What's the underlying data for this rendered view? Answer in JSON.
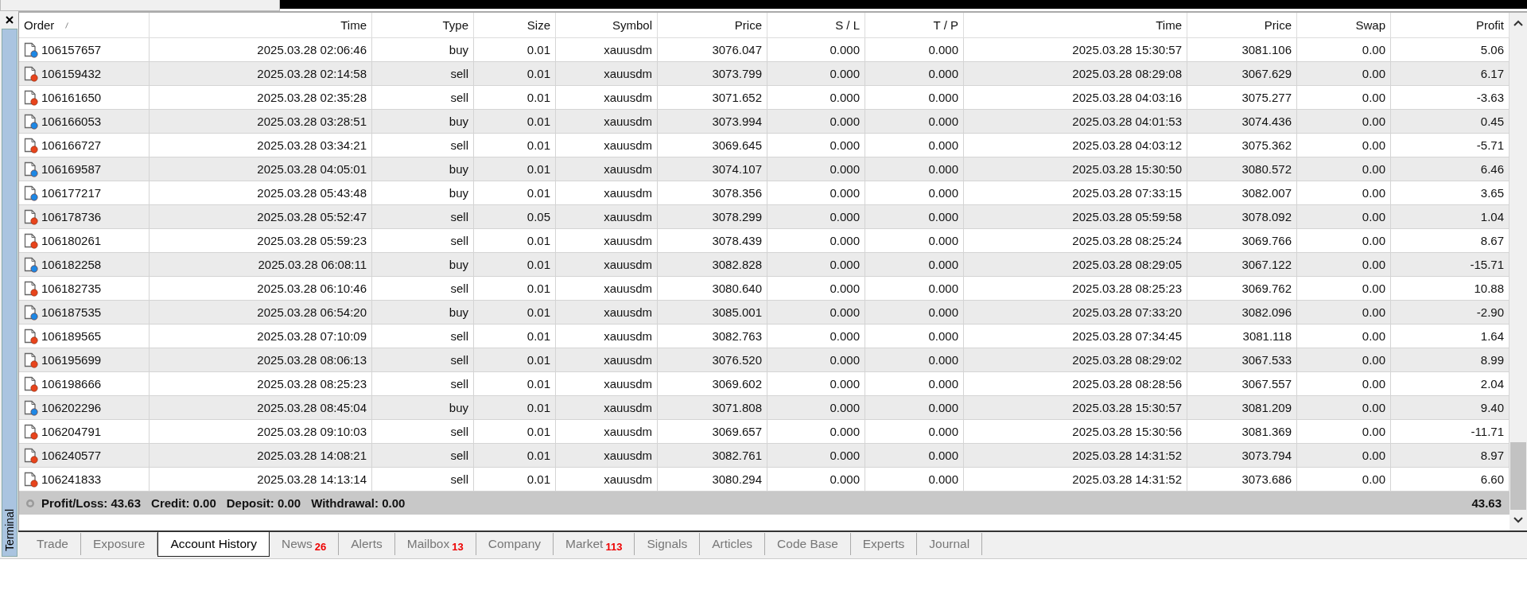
{
  "panel": {
    "title": "Terminal"
  },
  "table": {
    "columns": [
      {
        "label": "Order",
        "sorted": true
      },
      {
        "label": "Time",
        "sorted": false
      },
      {
        "label": "Type",
        "sorted": false
      },
      {
        "label": "Size",
        "sorted": false
      },
      {
        "label": "Symbol",
        "sorted": false
      },
      {
        "label": "Price",
        "sorted": false
      },
      {
        "label": "S / L",
        "sorted": false
      },
      {
        "label": "T / P",
        "sorted": false
      },
      {
        "label": "Time",
        "sorted": false
      },
      {
        "label": "Price",
        "sorted": false
      },
      {
        "label": "Swap",
        "sorted": false
      },
      {
        "label": "Profit",
        "sorted": false
      }
    ],
    "rows": [
      {
        "kind": "buy",
        "cells": [
          "106157657",
          "2025.03.28 02:06:46",
          "buy",
          "0.01",
          "xauusdm",
          "3076.047",
          "0.000",
          "0.000",
          "2025.03.28 15:30:57",
          "3081.106",
          "0.00",
          "5.06"
        ]
      },
      {
        "kind": "sell",
        "cells": [
          "106159432",
          "2025.03.28 02:14:58",
          "sell",
          "0.01",
          "xauusdm",
          "3073.799",
          "0.000",
          "0.000",
          "2025.03.28 08:29:08",
          "3067.629",
          "0.00",
          "6.17"
        ]
      },
      {
        "kind": "sell",
        "cells": [
          "106161650",
          "2025.03.28 02:35:28",
          "sell",
          "0.01",
          "xauusdm",
          "3071.652",
          "0.000",
          "0.000",
          "2025.03.28 04:03:16",
          "3075.277",
          "0.00",
          "-3.63"
        ]
      },
      {
        "kind": "buy",
        "cells": [
          "106166053",
          "2025.03.28 03:28:51",
          "buy",
          "0.01",
          "xauusdm",
          "3073.994",
          "0.000",
          "0.000",
          "2025.03.28 04:01:53",
          "3074.436",
          "0.00",
          "0.45"
        ]
      },
      {
        "kind": "sell",
        "cells": [
          "106166727",
          "2025.03.28 03:34:21",
          "sell",
          "0.01",
          "xauusdm",
          "3069.645",
          "0.000",
          "0.000",
          "2025.03.28 04:03:12",
          "3075.362",
          "0.00",
          "-5.71"
        ]
      },
      {
        "kind": "buy",
        "cells": [
          "106169587",
          "2025.03.28 04:05:01",
          "buy",
          "0.01",
          "xauusdm",
          "3074.107",
          "0.000",
          "0.000",
          "2025.03.28 15:30:50",
          "3080.572",
          "0.00",
          "6.46"
        ]
      },
      {
        "kind": "buy",
        "cells": [
          "106177217",
          "2025.03.28 05:43:48",
          "buy",
          "0.01",
          "xauusdm",
          "3078.356",
          "0.000",
          "0.000",
          "2025.03.28 07:33:15",
          "3082.007",
          "0.00",
          "3.65"
        ]
      },
      {
        "kind": "sell",
        "cells": [
          "106178736",
          "2025.03.28 05:52:47",
          "sell",
          "0.05",
          "xauusdm",
          "3078.299",
          "0.000",
          "0.000",
          "2025.03.28 05:59:58",
          "3078.092",
          "0.00",
          "1.04"
        ]
      },
      {
        "kind": "sell",
        "cells": [
          "106180261",
          "2025.03.28 05:59:23",
          "sell",
          "0.01",
          "xauusdm",
          "3078.439",
          "0.000",
          "0.000",
          "2025.03.28 08:25:24",
          "3069.766",
          "0.00",
          "8.67"
        ]
      },
      {
        "kind": "buy",
        "cells": [
          "106182258",
          "2025.03.28 06:08:11",
          "buy",
          "0.01",
          "xauusdm",
          "3082.828",
          "0.000",
          "0.000",
          "2025.03.28 08:29:05",
          "3067.122",
          "0.00",
          "-15.71"
        ]
      },
      {
        "kind": "sell",
        "cells": [
          "106182735",
          "2025.03.28 06:10:46",
          "sell",
          "0.01",
          "xauusdm",
          "3080.640",
          "0.000",
          "0.000",
          "2025.03.28 08:25:23",
          "3069.762",
          "0.00",
          "10.88"
        ]
      },
      {
        "kind": "buy",
        "cells": [
          "106187535",
          "2025.03.28 06:54:20",
          "buy",
          "0.01",
          "xauusdm",
          "3085.001",
          "0.000",
          "0.000",
          "2025.03.28 07:33:20",
          "3082.096",
          "0.00",
          "-2.90"
        ]
      },
      {
        "kind": "sell",
        "cells": [
          "106189565",
          "2025.03.28 07:10:09",
          "sell",
          "0.01",
          "xauusdm",
          "3082.763",
          "0.000",
          "0.000",
          "2025.03.28 07:34:45",
          "3081.118",
          "0.00",
          "1.64"
        ]
      },
      {
        "kind": "sell",
        "cells": [
          "106195699",
          "2025.03.28 08:06:13",
          "sell",
          "0.01",
          "xauusdm",
          "3076.520",
          "0.000",
          "0.000",
          "2025.03.28 08:29:02",
          "3067.533",
          "0.00",
          "8.99"
        ]
      },
      {
        "kind": "sell",
        "cells": [
          "106198666",
          "2025.03.28 08:25:23",
          "sell",
          "0.01",
          "xauusdm",
          "3069.602",
          "0.000",
          "0.000",
          "2025.03.28 08:28:56",
          "3067.557",
          "0.00",
          "2.04"
        ]
      },
      {
        "kind": "buy",
        "cells": [
          "106202296",
          "2025.03.28 08:45:04",
          "buy",
          "0.01",
          "xauusdm",
          "3071.808",
          "0.000",
          "0.000",
          "2025.03.28 15:30:57",
          "3081.209",
          "0.00",
          "9.40"
        ]
      },
      {
        "kind": "sell",
        "cells": [
          "106204791",
          "2025.03.28 09:10:03",
          "sell",
          "0.01",
          "xauusdm",
          "3069.657",
          "0.000",
          "0.000",
          "2025.03.28 15:30:56",
          "3081.369",
          "0.00",
          "-11.71"
        ]
      },
      {
        "kind": "sell",
        "cells": [
          "106240577",
          "2025.03.28 14:08:21",
          "sell",
          "0.01",
          "xauusdm",
          "3082.761",
          "0.000",
          "0.000",
          "2025.03.28 14:31:52",
          "3073.794",
          "0.00",
          "8.97"
        ]
      },
      {
        "kind": "sell",
        "cells": [
          "106241833",
          "2025.03.28 14:13:14",
          "sell",
          "0.01",
          "xauusdm",
          "3080.294",
          "0.000",
          "0.000",
          "2025.03.28 14:31:52",
          "3073.686",
          "0.00",
          "6.60"
        ]
      }
    ]
  },
  "summary": {
    "items": [
      "Profit/Loss: 43.63",
      "Credit: 0.00",
      "Deposit: 0.00",
      "Withdrawal: 0.00"
    ],
    "total": "43.63"
  },
  "tabs": [
    {
      "label": "Trade",
      "selected": false
    },
    {
      "label": "Exposure",
      "selected": false
    },
    {
      "label": "Account History",
      "selected": true
    },
    {
      "label": "News",
      "badge": "26",
      "selected": false
    },
    {
      "label": "Alerts",
      "selected": false
    },
    {
      "label": "Mailbox",
      "badge": "13",
      "selected": false
    },
    {
      "label": "Company",
      "selected": false
    },
    {
      "label": "Market",
      "badge": "113",
      "selected": false
    },
    {
      "label": "Signals",
      "selected": false
    },
    {
      "label": "Articles",
      "selected": false
    },
    {
      "label": "Code Base",
      "selected": false
    },
    {
      "label": "Experts",
      "selected": false
    },
    {
      "label": "Journal",
      "selected": false
    }
  ]
}
